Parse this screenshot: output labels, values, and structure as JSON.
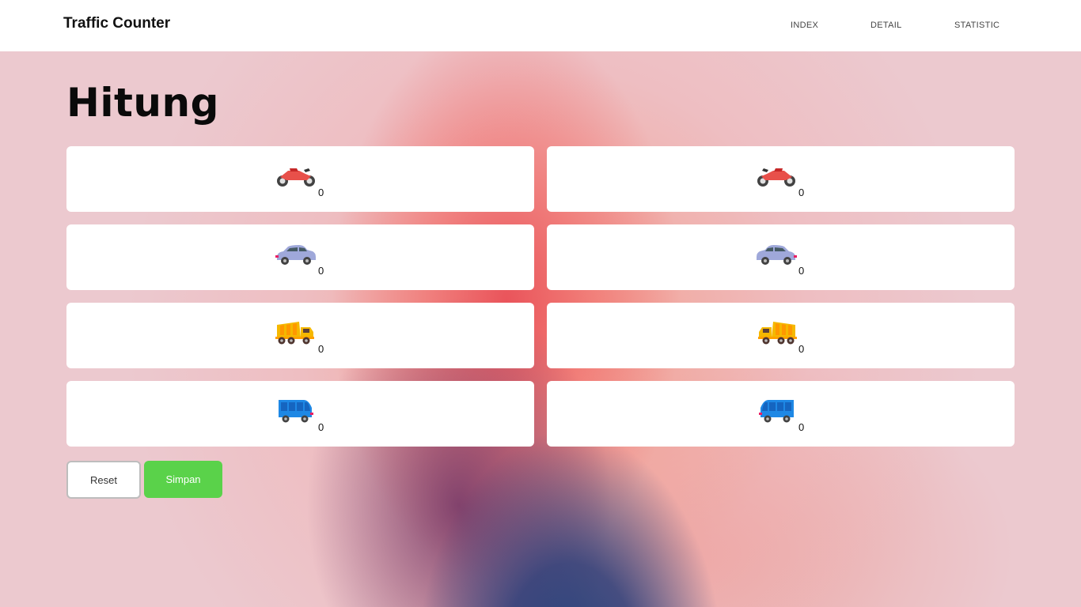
{
  "app": {
    "brand": "Traffic Counter"
  },
  "nav": {
    "items": [
      {
        "label": "INDEX"
      },
      {
        "label": "DETAIL"
      },
      {
        "label": "STATISTIC"
      }
    ]
  },
  "page": {
    "title": "Hitung"
  },
  "counters": {
    "left": [
      {
        "icon": "motorcycle-icon",
        "count": "0"
      },
      {
        "icon": "car-icon",
        "count": "0"
      },
      {
        "icon": "dump-truck-icon",
        "count": "0"
      },
      {
        "icon": "bus-icon",
        "count": "0"
      }
    ],
    "right": [
      {
        "icon": "motorcycle-icon",
        "count": "0"
      },
      {
        "icon": "car-icon",
        "count": "0"
      },
      {
        "icon": "dump-truck-icon",
        "count": "0"
      },
      {
        "icon": "bus-icon",
        "count": "0"
      }
    ]
  },
  "actions": {
    "reset_label": "Reset",
    "save_label": "Simpan"
  },
  "colors": {
    "save_button": "#5ad24a",
    "motorcycle": "#e8504a",
    "car": "#9fa8da",
    "truck": "#f5b800",
    "bus": "#1e88e5"
  }
}
